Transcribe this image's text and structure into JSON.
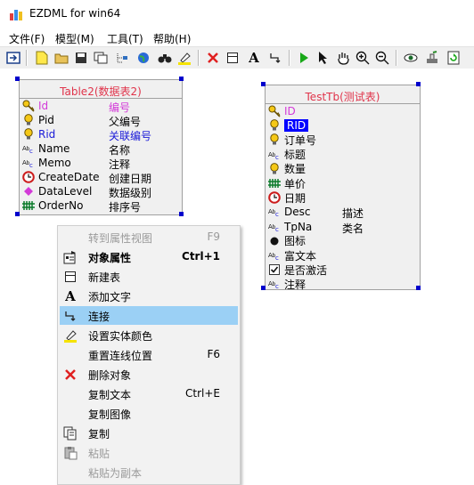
{
  "window": {
    "title": "EZDML for win64"
  },
  "menu": [
    "文件(F)",
    "模型(M)",
    "工具(T)",
    "帮助(H)"
  ],
  "toolbar": {
    "icons": [
      "export-icon",
      "new-file-icon",
      "open-folder-icon",
      "save-icon",
      "copy-window-icon",
      "tree-icon",
      "globe-icon",
      "binoculars-icon",
      "highlighter-icon",
      "delete-icon",
      "table-icon",
      "text-icon",
      "link-icon",
      "run-icon",
      "pointer-icon",
      "hand-icon",
      "zoom-in-icon",
      "zoom-out-icon",
      "view-icon",
      "stamp-icon",
      "refresh-icon"
    ]
  },
  "table1": {
    "title": "Table2(数据表2)",
    "fields": [
      {
        "name": "Id",
        "label": "编号",
        "type": "pk",
        "icon": "key-icon"
      },
      {
        "name": "Pid",
        "label": "父编号",
        "type": "normal",
        "icon": "lightbulb-icon"
      },
      {
        "name": "Rid",
        "label": "关联编号",
        "type": "fk",
        "icon": "lightbulb-icon"
      },
      {
        "name": "Name",
        "label": "名称",
        "type": "normal",
        "icon": "text-type-icon"
      },
      {
        "name": "Memo",
        "label": "注释",
        "type": "normal",
        "icon": "text-type-icon"
      },
      {
        "name": "CreateDate",
        "label": "创建日期",
        "type": "normal",
        "icon": "clock-icon"
      },
      {
        "name": "DataLevel",
        "label": "数据级别",
        "type": "normal",
        "icon": "enum-icon"
      },
      {
        "name": "OrderNo",
        "label": "排序号",
        "type": "normal",
        "icon": "number-icon"
      }
    ]
  },
  "table2": {
    "title": "TestTb(测试表)",
    "fields": [
      {
        "name": "ID",
        "label": "",
        "type": "pk",
        "icon": "key-icon"
      },
      {
        "name": "RID",
        "label": "",
        "type": "selected",
        "icon": "lightbulb-icon"
      },
      {
        "name": "订单号",
        "label": "",
        "type": "normal",
        "icon": "lightbulb-icon"
      },
      {
        "name": "标题",
        "label": "",
        "type": "normal",
        "icon": "text-type-icon"
      },
      {
        "name": "数量",
        "label": "",
        "type": "normal",
        "icon": "lightbulb-icon"
      },
      {
        "name": "单价",
        "label": "",
        "type": "normal",
        "icon": "number-icon"
      },
      {
        "name": "日期",
        "label": "",
        "type": "normal",
        "icon": "clock-icon"
      },
      {
        "name": "Desc",
        "label": "描述",
        "type": "normal",
        "icon": "text-type-icon"
      },
      {
        "name": "TpNa",
        "label": "类名",
        "type": "normal",
        "icon": "text-type-icon"
      },
      {
        "name": "图标",
        "label": "",
        "type": "normal",
        "icon": "dot-icon"
      },
      {
        "name": "富文本",
        "label": "",
        "type": "normal",
        "icon": "text-type-icon"
      },
      {
        "name": "是否激活",
        "label": "",
        "type": "normal",
        "icon": "checkbox-icon"
      },
      {
        "name": "注释",
        "label": "",
        "type": "normal",
        "icon": "text-type-icon"
      }
    ]
  },
  "context_menu": [
    {
      "label": "转到属性视图",
      "shortcut": "F9",
      "disabled": true,
      "bold": false,
      "icon": ""
    },
    {
      "label": "对象属性",
      "shortcut": "Ctrl+1",
      "disabled": false,
      "bold": true,
      "icon": "properties-icon"
    },
    {
      "label": "新建表",
      "shortcut": "",
      "disabled": false,
      "bold": false,
      "icon": "table-icon"
    },
    {
      "label": "添加文字",
      "shortcut": "",
      "disabled": false,
      "bold": false,
      "icon": "text-icon"
    },
    {
      "label": "连接",
      "shortcut": "",
      "disabled": false,
      "bold": false,
      "icon": "link-icon",
      "highlighted": true
    },
    {
      "label": "设置实体颜色",
      "shortcut": "",
      "disabled": false,
      "bold": false,
      "icon": "highlighter-icon"
    },
    {
      "label": "重置连线位置",
      "shortcut": "F6",
      "disabled": false,
      "bold": false,
      "icon": ""
    },
    {
      "label": "删除对象",
      "shortcut": "",
      "disabled": false,
      "bold": false,
      "icon": "delete-icon"
    },
    {
      "label": "复制文本",
      "shortcut": "Ctrl+E",
      "disabled": false,
      "bold": false,
      "icon": ""
    },
    {
      "label": "复制图像",
      "shortcut": "",
      "disabled": false,
      "bold": false,
      "icon": ""
    },
    {
      "label": "复制",
      "shortcut": "",
      "disabled": false,
      "bold": false,
      "icon": "copy-icon"
    },
    {
      "label": "粘贴",
      "shortcut": "",
      "disabled": true,
      "bold": false,
      "icon": "paste-icon"
    },
    {
      "label": "粘贴为副本",
      "shortcut": "",
      "disabled": true,
      "bold": false,
      "icon": ""
    }
  ],
  "colors": {
    "title_red": "#e0334a",
    "pk": "#d33ad8",
    "fk": "#1a1ad8",
    "handle": "#0000cc",
    "highlight": "#9bd0f5",
    "selected": "#0000ff"
  }
}
